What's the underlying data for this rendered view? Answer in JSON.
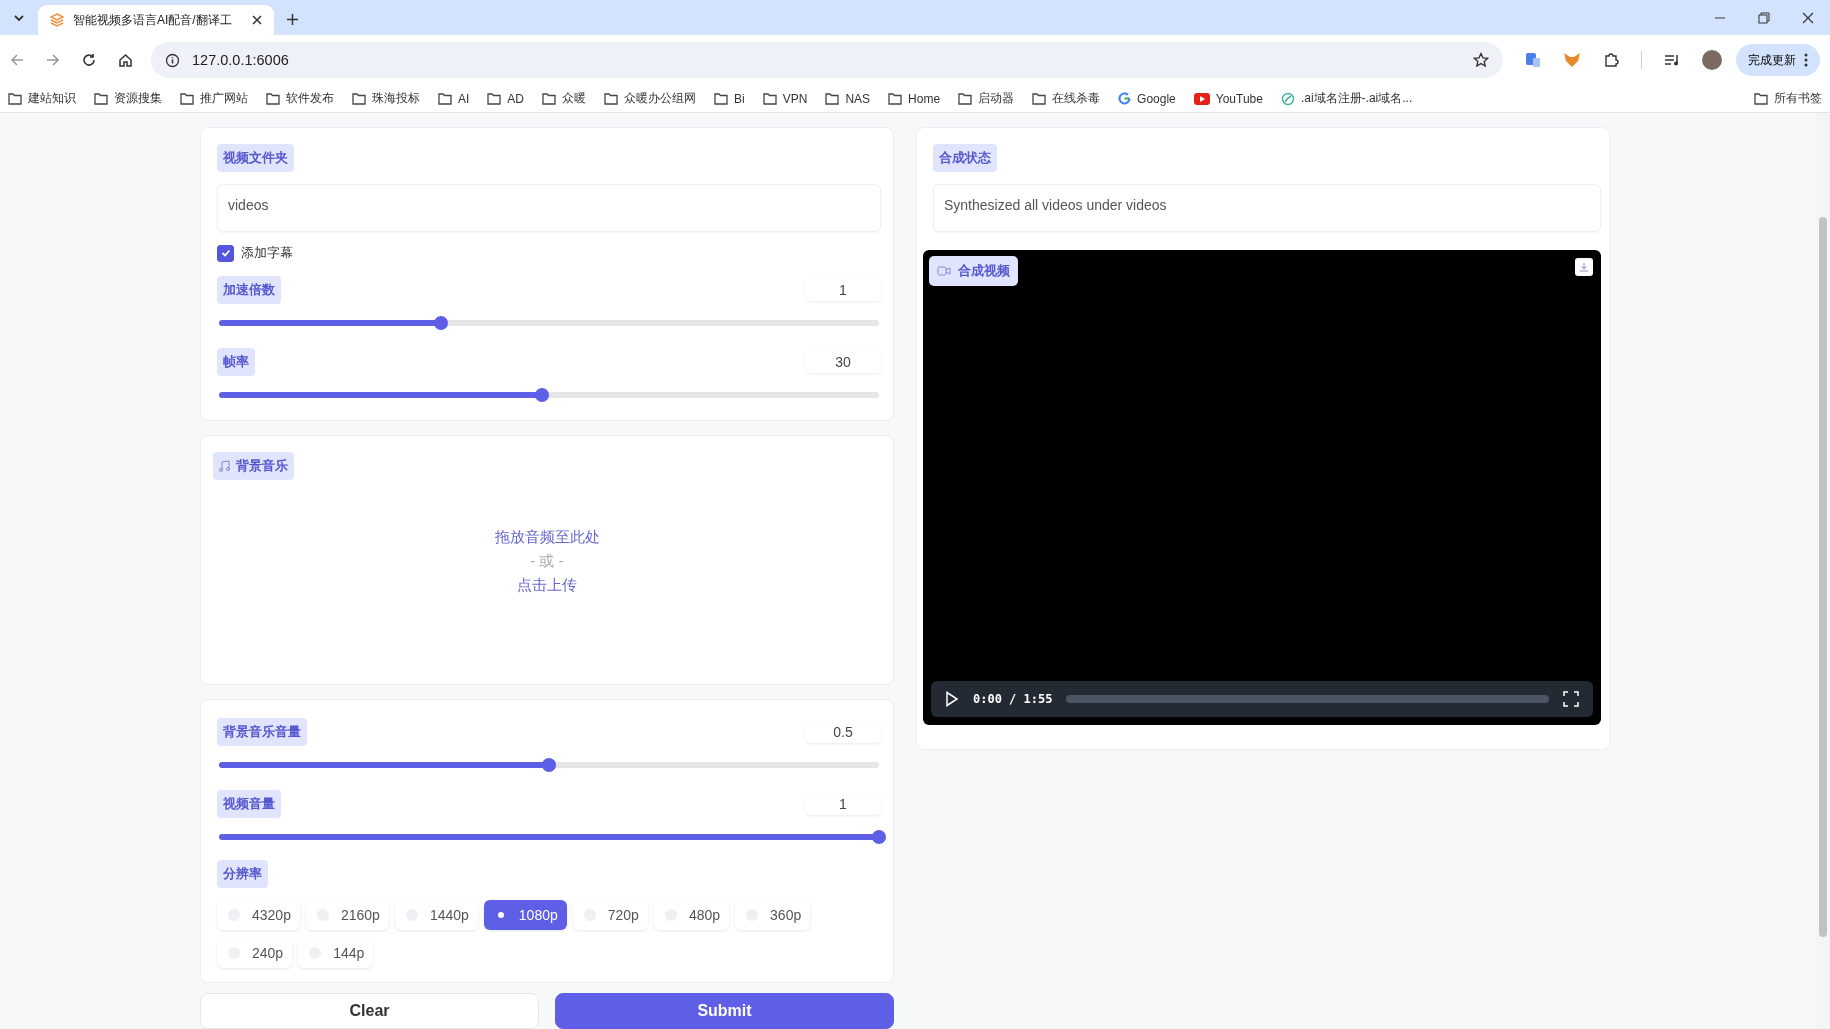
{
  "browser": {
    "tab_title": "智能视频多语言AI配音/翻译工",
    "url": "127.0.0.1:6006",
    "update_button": "完成更新",
    "bookmarks": [
      {
        "label": "建站知识",
        "kind": "folder"
      },
      {
        "label": "资源搜集",
        "kind": "folder"
      },
      {
        "label": "推广网站",
        "kind": "folder"
      },
      {
        "label": "软件发布",
        "kind": "folder"
      },
      {
        "label": "珠海投标",
        "kind": "folder"
      },
      {
        "label": "AI",
        "kind": "folder"
      },
      {
        "label": "AD",
        "kind": "folder"
      },
      {
        "label": "众暖",
        "kind": "folder"
      },
      {
        "label": "众暖办公组网",
        "kind": "folder"
      },
      {
        "label": "Bi",
        "kind": "folder"
      },
      {
        "label": "VPN",
        "kind": "folder"
      },
      {
        "label": "NAS",
        "kind": "folder"
      },
      {
        "label": "Home",
        "kind": "folder"
      },
      {
        "label": "启动器",
        "kind": "folder"
      },
      {
        "label": "在线杀毒",
        "kind": "folder"
      },
      {
        "label": "Google",
        "kind": "google"
      },
      {
        "label": "YouTube",
        "kind": "youtube"
      },
      {
        "label": ".ai域名注册-.ai域名...",
        "kind": "site"
      }
    ],
    "all_bookmarks": "所有书签"
  },
  "left": {
    "video_folder": {
      "label": "视频文件夹",
      "value": "videos"
    },
    "subtitle": {
      "label": "添加字幕",
      "checked": true
    },
    "sliders": [
      {
        "label": "加速倍数",
        "value": "1",
        "level": 0.336
      },
      {
        "label": "帧率",
        "value": "30",
        "level": 0.49
      }
    ],
    "music": {
      "label": "背景音乐",
      "drop_text": "拖放音频至此处",
      "or_text": "- 或 -",
      "upload_text": "点击上传"
    },
    "sliders2": [
      {
        "label": "背景音乐音量",
        "value": "0.5",
        "level": 0.5
      },
      {
        "label": "视频音量",
        "value": "1",
        "level": 1
      }
    ],
    "resolution": {
      "label": "分辨率",
      "options": [
        {
          "label": "4320p",
          "selected": false
        },
        {
          "label": "2160p",
          "selected": false
        },
        {
          "label": "1440p",
          "selected": false
        },
        {
          "label": "1080p",
          "selected": true
        },
        {
          "label": "720p",
          "selected": false
        },
        {
          "label": "480p",
          "selected": false
        },
        {
          "label": "360p",
          "selected": false
        },
        {
          "label": "240p",
          "selected": false
        },
        {
          "label": "144p",
          "selected": false
        }
      ]
    },
    "clear_button": "Clear",
    "submit_button": "Submit"
  },
  "right": {
    "status": {
      "label": "合成状态",
      "value": "Synthesized all videos under videos"
    },
    "video": {
      "label": "合成视频",
      "time": "0:00 / 1:55"
    }
  }
}
